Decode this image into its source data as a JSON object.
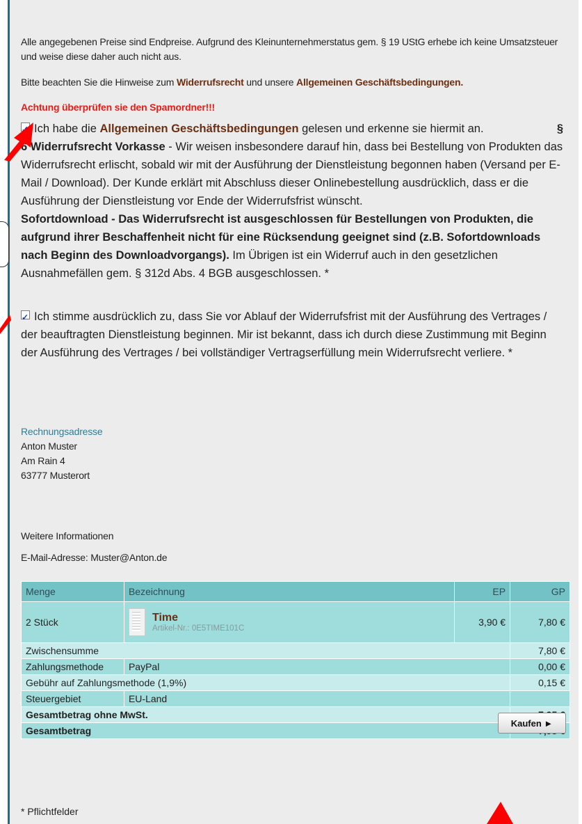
{
  "notice": {
    "line1": "Alle angegebenen Preise sind Endpreise.  Aufgrund des Kleinunternehmerstatus gem. § 19 UStG erhebe ich keine Umsatzsteuer und weise diese daher auch nicht aus.",
    "hint_pre": "Bitte beachten Sie die Hinweise zum ",
    "hint_link1": "Widerrufsrecht",
    "hint_mid": " und unsere ",
    "hint_link2": "Allgemeinen Geschäftsbedingungen.",
    "warning": "Achtung überprüfen sie den Spamordner!!!"
  },
  "agb": {
    "text_pre": "Ich habe die ",
    "link": "Allgemeinen Geschäftsbedingungen",
    "text_post": " gelesen und erkenne sie hiermit an.",
    "para_mark": "§",
    "title": "6 Widerrufsrecht Vorkasse",
    "body": " - Wir weisen insbesondere darauf hin, dass bei Bestellung von Produkten das Widerrufsrecht erlischt, sobald wir mit der Ausführung der Dienstleistung begonnen haben (Versand per E-Mail / Download). Der Kunde erklärt mit Abschluss dieser Onlinebestellung ausdrücklich, dass er die Ausführung der Dienstleistung vor Ende der Widerrufsfrist wünscht.",
    "sofort_bold": "Sofortdownload - Das Widerrufsrecht ist ausgeschlossen für Bestellungen von Produkten, die aufgrund ihrer Beschaffenheit nicht für eine Rücksendung geeignet sind (z.B. Sofortdownloads nach Beginn des Downloadvorgangs).",
    "sofort_rest": " Im Übrigen ist ein Widerruf auch in den gesetzlichen Ausnahmefällen gem. § 312d Abs. 4 BGB ausgeschlossen. *",
    "checked": true
  },
  "consent": {
    "text": "Ich stimme ausdrücklich zu, dass Sie vor Ablauf der Widerrufsfrist mit der Ausführung des Vertrages / der beauftragten Dienstleistung beginnen. Mir ist bekannt, dass ich durch diese Zustimmung mit Beginn der Ausführung des Vertrages / bei vollständiger Vertragserfüllung mein Widerrufsrecht verliere. *",
    "checked": true
  },
  "address": {
    "heading": "Rechnungsadresse",
    "name": "Anton Muster",
    "street": "Am Rain 4",
    "city": "63777 Musterort"
  },
  "info": {
    "heading": "Weitere Informationen",
    "email_label": "E-Mail-Adresse: ",
    "email": "Muster@Anton.de"
  },
  "table": {
    "headers": {
      "qty": "Menge",
      "desc": "Bezeichnung",
      "ep": "EP",
      "gp": "GP"
    },
    "item": {
      "qty": "2 Stück",
      "name": "Time",
      "art": "Artikel-Nr.: 0E5TIME101C",
      "ep": "3,90 €",
      "gp": "7,80 €"
    },
    "subtotal": {
      "label": "Zwischensumme",
      "value": "7,80 €"
    },
    "payment": {
      "label": "Zahlungsmethode",
      "method": "PayPal",
      "value": "0,00 €"
    },
    "fee": {
      "label": "Gebühr auf Zahlungsmethode (1,9%)",
      "value": "0,15 €"
    },
    "tax": {
      "label": "Steuergebiet",
      "region": "EU-Land"
    },
    "net": {
      "label": "Gesamtbetrag ohne MwSt.",
      "value": "7,95 €"
    },
    "total": {
      "label": "Gesamtbetrag",
      "value": "7,95 €"
    }
  },
  "buy_button": "Kaufen ►",
  "required_note": "* Pflichtfelder",
  "colors": {
    "link": "#6b2f12",
    "warning": "#e0201b",
    "table_head": "#72c2c6",
    "annotation_arrow": "#ff0000"
  }
}
